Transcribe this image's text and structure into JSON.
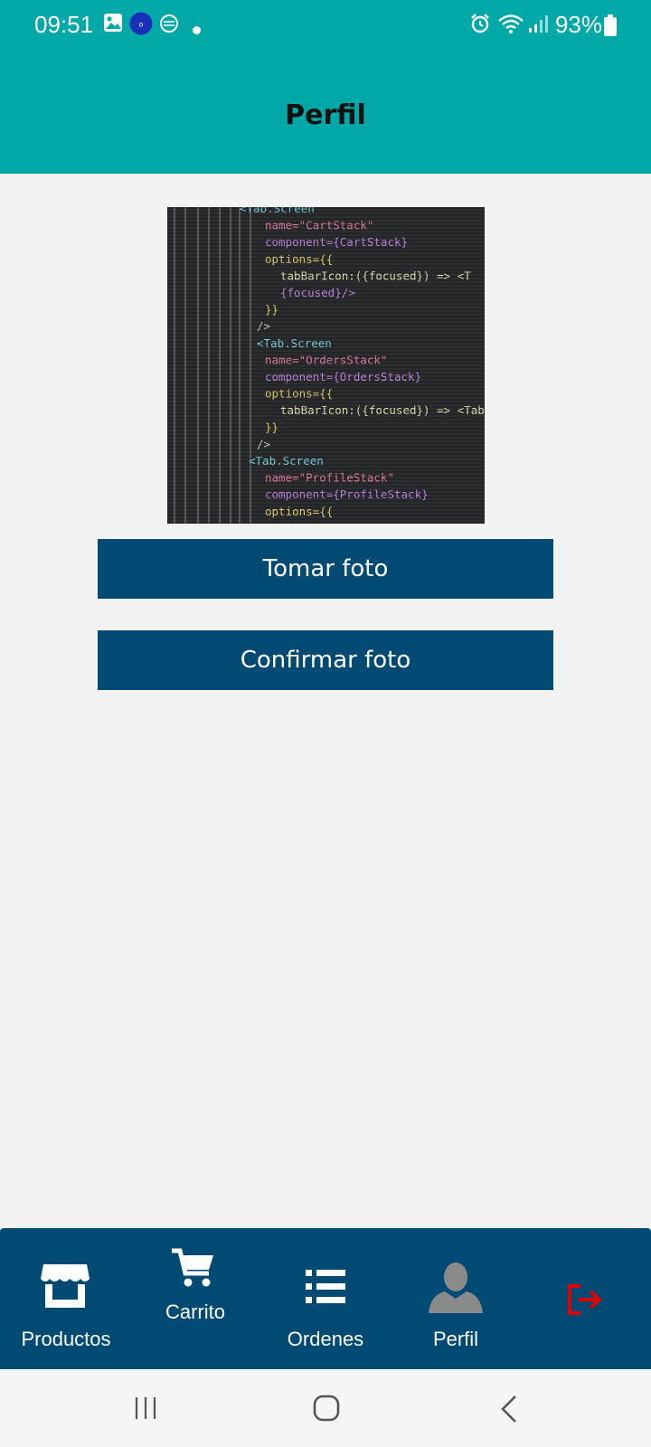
{
  "status_bar": {
    "time": "09:51",
    "battery": "93%",
    "icons": [
      "image-icon",
      "app-notification-icon",
      "vpn-icon",
      "dot-icon",
      "alarm-icon",
      "wifi-icon",
      "signal-icon",
      "battery-icon"
    ]
  },
  "header": {
    "title": "Perfil"
  },
  "photo": {
    "code_lines": [
      "<Tab.Screen",
      "name=\"CartStack\"",
      "component={CartStack}",
      "options={{",
      "tabBarIcon:({focused}) => <T",
      "{focused}/>",
      "}}",
      "/>",
      "<Tab.Screen",
      "name=\"OrdersStack\"",
      "component={OrdersStack}",
      "options={{",
      "tabBarIcon:({focused}) => <TabI",
      "}}",
      "/>",
      "<Tab.Screen",
      "name=\"ProfileStack\"",
      "component={ProfileStack}",
      "options={{"
    ]
  },
  "actions": {
    "take_photo": "Tomar foto",
    "confirm_photo": "Confirmar foto"
  },
  "tabbar": {
    "tabs": [
      {
        "label": "Productos",
        "icon": "store-icon"
      },
      {
        "label": "Carrito",
        "icon": "cart-icon"
      },
      {
        "label": "Ordenes",
        "icon": "list-icon"
      },
      {
        "label": "Perfil",
        "icon": "user-icon"
      },
      {
        "label": "",
        "icon": "logout-icon"
      }
    ],
    "logout_color": "#e00000"
  },
  "colors": {
    "header": "#00a8a8",
    "primary": "#004a73",
    "background": "#f2f2f2"
  },
  "system_nav": {
    "icons": [
      "recents-icon",
      "home-icon",
      "back-icon"
    ]
  }
}
